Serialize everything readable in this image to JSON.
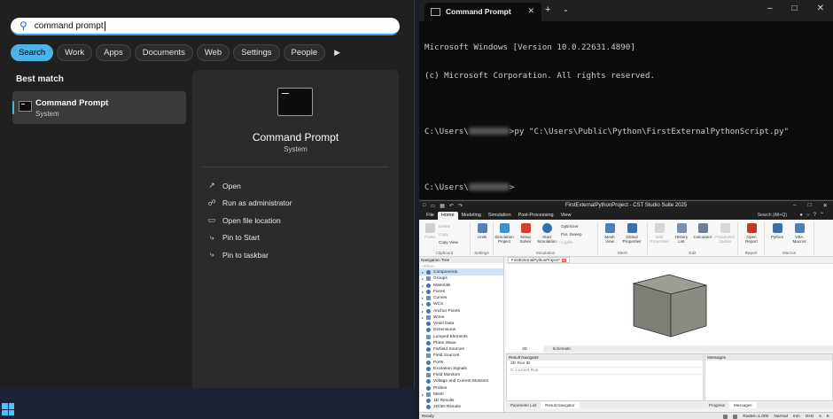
{
  "search": {
    "query": "command prompt",
    "filters": [
      "Search",
      "Work",
      "Apps",
      "Documents",
      "Web",
      "Settings",
      "People"
    ],
    "best_match_label": "Best match",
    "best_match": {
      "title": "Command Prompt",
      "subtitle": "System"
    },
    "detail": {
      "title": "Command Prompt",
      "subtitle": "System",
      "actions": [
        "Open",
        "Run as administrator",
        "Open file location",
        "Pin to Start",
        "Pin to taskbar"
      ]
    }
  },
  "terminal": {
    "tab_title": "Command Prompt",
    "line1": "Microsoft Windows [Version 10.0.22631.4890]",
    "line2": "(c) Microsoft Corporation. All rights reserved.",
    "prompt_prefix": "C:\\Users\\",
    "command_suffix": ">py \"C:\\Users\\Public\\Python\\FirstExternalPythonScript.py\"",
    "prompt_end": ">"
  },
  "cst": {
    "title": "FirstExternalPythonProject - CST Studio Suite 2025",
    "menu_tabs": [
      "File",
      "Home",
      "Modeling",
      "Simulation",
      "Post-Processing",
      "View"
    ],
    "active_menu": "Home",
    "search_placeholder": "Search (Alt+Q)",
    "ribbon": {
      "clipboard": {
        "paste": "Paste",
        "delete": "Delete",
        "copy": "Copy",
        "copy_view": "Copy View",
        "label": "Clipboard"
      },
      "settings": {
        "units": "Units",
        "label": "Settings"
      },
      "simulation": {
        "sim_project": "Simulation Project",
        "setup_solver": "Setup Solver",
        "start_sim": "Start Simulation",
        "optimizer": "Optimizer",
        "par_sweep": "Par. Sweep",
        "logfile": "Logfile",
        "label": "Simulation"
      },
      "mesh": {
        "mesh_view": "Mesh View",
        "global_props": "Global Properties",
        "label": "Mesh"
      },
      "edit": {
        "edit_props": "Edit Properties",
        "history_list": "History List",
        "calculator": "Calculator",
        "param_update": "Parametric Update",
        "label": "Edit"
      },
      "report": {
        "open_report": "Open Report",
        "label": "Report"
      },
      "macros": {
        "python": "Python",
        "vba": "VBA Macros",
        "label": "Macros"
      }
    },
    "nav_tree_title": "Navigation Tree",
    "nav_filter": "<Filter>",
    "nav_items": [
      "Components",
      "Groups",
      "Materials",
      "Faces",
      "Curves",
      "WCS",
      "Anchor Points",
      "Wires",
      "Voxel Data",
      "Dimensions",
      "Lumped Elements",
      "Plane Wave",
      "Farfield Sources",
      "Field Sources",
      "Ports",
      "Excitation Signals",
      "Field Monitors",
      "Voltage and Current Monitors",
      "Probes",
      "Mesh",
      "1D Results",
      "2D/3D Results"
    ],
    "view_tab": "FirstExternalPythonProject*",
    "view_sub_tabs": [
      "3D",
      "Schematic"
    ],
    "result_nav_title": "Result Navigator",
    "result_rows": [
      "3D Run ID",
      "0: Current Run"
    ],
    "result_tabs": [
      "Parameter List",
      "Result Navigator"
    ],
    "messages_title": "Messages",
    "messages_tabs": [
      "Progress",
      "Messages"
    ],
    "status_ready": "Ready",
    "status_right": [
      "Raster=1.000",
      "Normal",
      "mm",
      "GHz",
      "s",
      "K"
    ]
  },
  "colors": {
    "accent": "#4cb3e6",
    "cube": "#8b8a83"
  }
}
